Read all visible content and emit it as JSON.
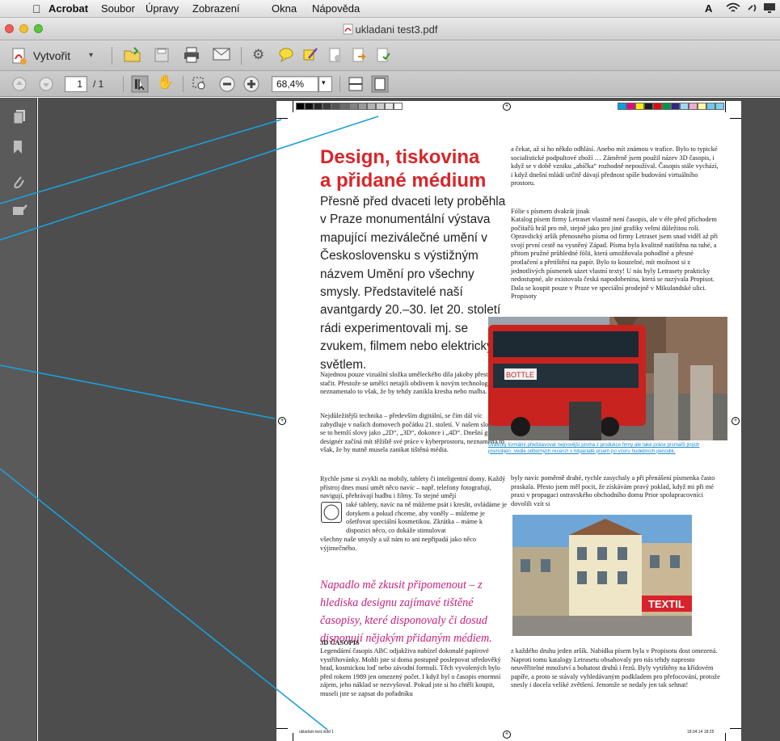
{
  "menubar": {
    "app_name": "Acrobat",
    "items": [
      "Soubor",
      "Úpravy",
      "Zobrazení",
      "Okna",
      "Nápověda"
    ]
  },
  "window": {
    "title": "ukladani test3.pdf"
  },
  "toolbar": {
    "create_label": "Vytvořit",
    "page_current": "1",
    "page_total": "/ 1",
    "zoom": "68,4%"
  },
  "colors": {
    "accent_red": "#d7262a",
    "pull_magenta": "#c81f7c",
    "caption_blue": "#1b8ac9",
    "annotation_line": "#1aa0dc"
  },
  "document": {
    "title_line1": "Design, tiskovina",
    "title_line2": "a přidané médium",
    "lead": "Přesně před dvaceti lety proběhla v Praze monumentální výstava mapující meziválečné umění v Československu s výstižným názvem Umění pro všechny smysly. Představitelé naší avantgardy 20.–30. let 20. století rádi experimentovali mj. se zvukem, filmem nebo elektrickým světlem.",
    "p1": "Najednou pouze vizuální složka uměleckého díla jakoby přestávala stačit. Přestože se umělci netajili obdivem k novým technologiím, neznamenalo to však, že by tehdy zanikla kresba nebo malba.",
    "p2": "Nejdůležitější technika – především digitální, se čím dál víc zabydluje v našich domovech počátku 21. století. V našem slovníku se to hemží slovy jako „2D“, „3D“, dokonce i „4D“. Dnešní grafický designér začíná mít těžiště své práce v kyberprostoru, neznamená to však, že by nutně musela zanikat tištěná média.",
    "p3a": "Rychle jsme si zvykli na mobily, tablety či inteligentní domy. Každý přístroj dnes musí umět něco navíc – např. telefony fotografují, navigují, přehrávají hudbu i filmy. To stejné umějí",
    "p3b": "také tablety, navíc na ně můžeme psát i kreslit, ovládáme je dotykem a pokud chceme, aby voněly – můžeme je ošetřovat speciální kosmetikou. Zkrátka – máme k dispozici něco, co dokáže stimulovat",
    "p3c": "všechny naše smysly a už nám to ani nepřipadá jako něco výjimečného.",
    "pull_quote": "Napadlo mě zkusit připomenout – z hlediska designu zajímavé tištěné časopisy, které disponovaly či dosud disponují nějakým přidaným médiem.",
    "section_heading": "3D ČASOPIS",
    "p4": "Legendární časopis ABC odjakživa nabízel dokonalé papírové vystřihovánky. Mohli jste si doma postupně poslepovat středověký hrad, kosmickou loď nebo závodní formuli. Těch vyvolených bylo před rokem 1989 jen omezený počet. I když byl o časopis enormní zájem, jeho náklad se nezvyšoval. Pokud jste si ho chtěli koupit, museli jste se zapsat do pořadníku",
    "r1": "a čekat, až si ho někdo odhlásí. Anebo mít známou v trafice. Bylo to typické socialistické podpultové zboží … Záměrně jsem použil název 3D časopis, i když se v době vzniku „abíčka“ rozhodně nepoužíval. Časopis stále vychází, i když dnešní mládí určitě dávají přednost spíše budování virtuálního prostoru.",
    "r2_heading": "Fólie s písmem dvakrát jinak",
    "r2": "Katalog písem firmy Letraset vlastně není časopis, ale v éře před příchodem počítačů hrál pro mě, stejně jako pro jiné grafiky velmi důležitou roli. Opravdický aršík přenosného písma od firmy Letraset jsem snad viděl až při svojí první cestě na vysněný Západ. Písma byla kvalitně natištěna na tuhé, a přitom pružné průhledné fólii, která umožňovala pohodlné a přesné protlačení a přetištění na papír. Bylo to kouzelné, mít možnost si z jednotlivých písmenek sázet vlastní texty! U nás byly Letrasety prakticky nedostupné, ale existovala česká napodobenina, která se nazývala Propisot. Dala se koupit pouze v Praze ve speciální prodejně v Mikulandské ulici. Propisoty",
    "caption": "Graficky formální představovat nejnovější písma z produkce firmy ale také práce písmařů jiných písmolijen. Vedle odborných recenzí v hitparádě písem po vzoru hudebních periodik.",
    "r3": "byly navíc poměrně drahé, rychle zasychaly a při přenášení písmenka často praskala. Přesto jsem měl pocit, že získávám pravý poklad, když mi při mé praxi v propagaci ostravského obchodního domu Prior spolupracovníci dovolili vzít si",
    "r4": "z každého druhu jeden aršík. Nabídka písem byla v Propisotu dost omezená. Naproti tomu katalogy Letrasetu obsahovaly pro nás tehdy naprosto neuvěřitelné množství a bohatost druhů i řezů. Byly vytištěny na křídovém papíře, a proto se stávaly vyhledávaným podkladem pro přefocování, protože snesly i docela veliké zvětšení. Jenomže se nedaly jen tak sehnat!",
    "footer_left": "ukladani test.indd  1",
    "footer_right": "18.04.14  18:25",
    "bus_sign": "BOTTLE"
  },
  "image_sign": "TEXTIL"
}
